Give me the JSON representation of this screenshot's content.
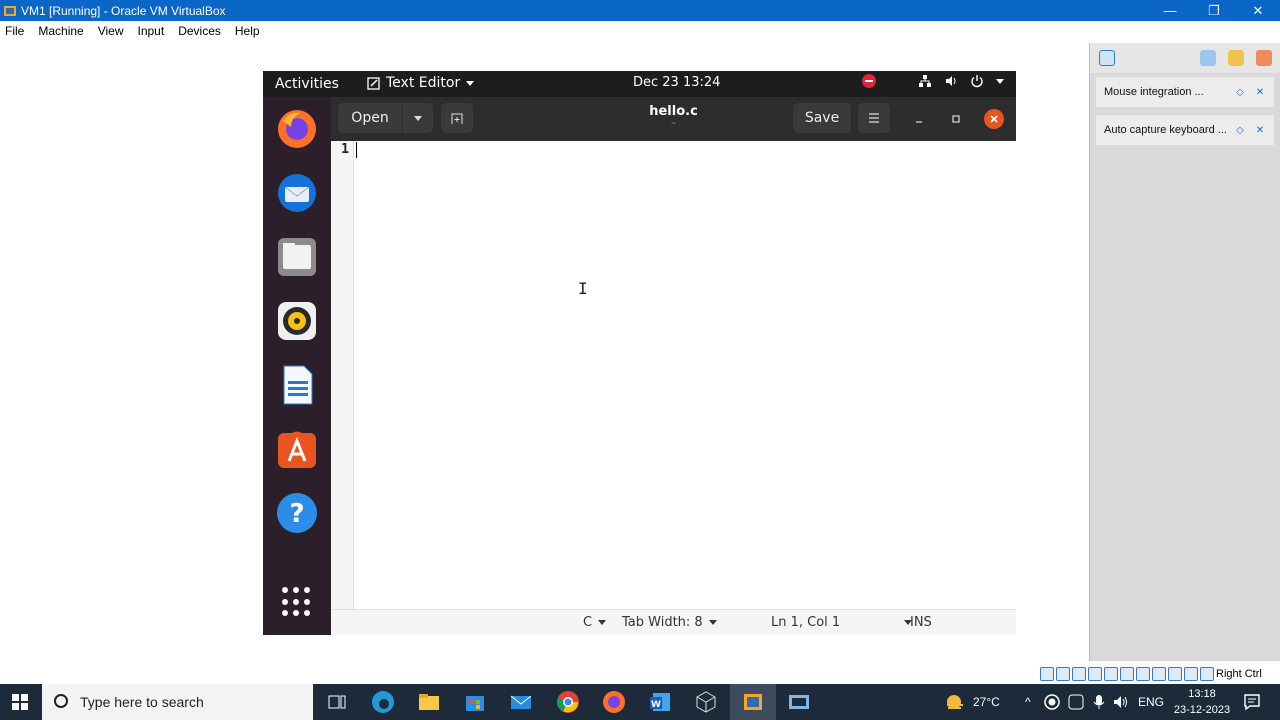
{
  "host": {
    "title": "VM1 [Running] - Oracle VM VirtualBox",
    "controls": {
      "minimize": "—",
      "restore": "❐",
      "close": "✕"
    },
    "menu": [
      "File",
      "Machine",
      "View",
      "Input",
      "Devices",
      "Help"
    ]
  },
  "guest": {
    "topbar": {
      "activities": "Activities",
      "app_menu": "Text Editor",
      "clock": "Dec 23  13:24"
    },
    "dock_apps": [
      "firefox-icon",
      "thunderbird-icon",
      "files-icon",
      "rhythmbox-icon",
      "libreoffice-writer-icon",
      "app-center-icon",
      "help-icon"
    ],
    "editor": {
      "open_label": "Open",
      "title": "hello.c",
      "subtitle": "~",
      "save_label": "Save",
      "line_number": "1"
    },
    "statusbar": {
      "language": "C",
      "tab_width": "Tab Width: 8",
      "position": "Ln 1, Col 1",
      "mode": "INS"
    }
  },
  "vbox_panel": {
    "notices": [
      "Mouse integration ...",
      "Auto capture keyboard ..."
    ],
    "host_key": "Right Ctrl"
  },
  "taskbar": {
    "search_placeholder": "Type here to search",
    "weather": "27°C",
    "language": "ENG",
    "time": "13:18",
    "date": "23-12-2023"
  },
  "colors": {
    "host_titlebar": "#0a67c8",
    "dock": "#2b1f2a",
    "headerbar": "#2d2d2d",
    "accent_orange": "#e95420",
    "taskbar": "#1c2a3a"
  }
}
